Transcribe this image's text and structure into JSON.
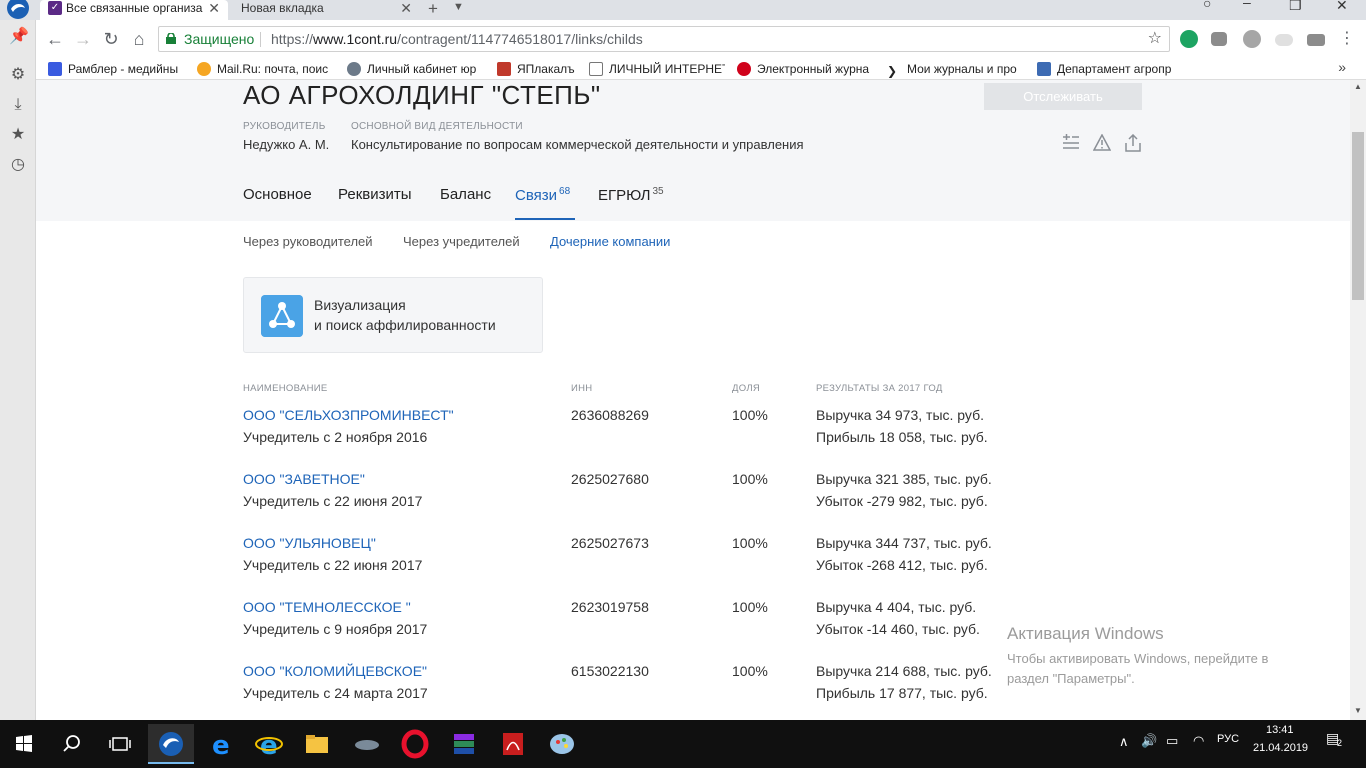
{
  "browser": {
    "tabs": [
      {
        "title": "Все связанные организа",
        "active": true
      },
      {
        "title": "Новая вкладка",
        "active": false
      }
    ],
    "security_label": "Защищено",
    "url_prefix": "https://",
    "url_host": "www.1cont.ru",
    "url_path": "/contragent/1147746518017/links/childs",
    "bookmarks": [
      "Рамблер - медийны",
      "Mail.Ru: почта, поис",
      "Личный кабинет юр",
      "ЯПлакалъ",
      "ЛИЧНЫЙ ИНТЕРНЕТ",
      "Электронный журна",
      "Мои журналы и про",
      "Департамент агропр"
    ]
  },
  "company": {
    "title": "АО АГРОХОЛДИНГ \"СТЕПЬ\"",
    "track_button": "Отслеживать",
    "director_label": "РУКОВОДИТЕЛЬ",
    "director_value": "Недужко А. М.",
    "activity_label": "ОСНОВНОЙ ВИД ДЕЯТЕЛЬНОСТИ",
    "activity_value": "Консультирование по вопросам коммерческой деятельности и управления"
  },
  "tabs": [
    {
      "label": "Основное",
      "count": ""
    },
    {
      "label": "Реквизиты",
      "count": ""
    },
    {
      "label": "Баланс",
      "count": ""
    },
    {
      "label": "Связи",
      "count": "68"
    },
    {
      "label": "ЕГРЮЛ",
      "count": "35"
    }
  ],
  "subnav": [
    "Через руководителей",
    "Через учредителей",
    "Дочерние компании"
  ],
  "viz_card": {
    "line1": "Визуализация",
    "line2": "и поиск аффилированности"
  },
  "table": {
    "headers": [
      "НАИМЕНОВАНИЕ",
      "ИНН",
      "ДОЛЯ",
      "РЕЗУЛЬТАТЫ ЗА 2017 ГОД"
    ],
    "rows": [
      {
        "name": "ООО \"СЕЛЬХОЗПРОМИНВЕСТ\"",
        "since": "Учредитель с 2 ноября 2016",
        "inn": "2636088269",
        "share": "100%",
        "r1": "Выручка 34 973, тыс. руб.",
        "r2": "Прибыль 18 058, тыс. руб."
      },
      {
        "name": "ООО \"ЗАВЕТНОЕ\"",
        "since": "Учредитель с 22 июня 2017",
        "inn": "2625027680",
        "share": "100%",
        "r1": "Выручка 321 385, тыс. руб.",
        "r2": "Убыток -279 982, тыс. руб."
      },
      {
        "name": "ООО \"УЛЬЯНОВЕЦ\"",
        "since": "Учредитель с 22 июня 2017",
        "inn": "2625027673",
        "share": "100%",
        "r1": "Выручка 344 737, тыс. руб.",
        "r2": "Убыток -268 412, тыс. руб."
      },
      {
        "name": "ООО \"ТЕМНОЛЕССКОЕ \"",
        "since": "Учредитель с 9 ноября 2017",
        "inn": "2623019758",
        "share": "100%",
        "r1": "Выручка 4 404, тыс. руб.",
        "r2": "Убыток -14 460, тыс. руб."
      },
      {
        "name": "ООО \"КОЛОМИЙЦЕВСКОЕ\"",
        "since": "Учредитель с 24 марта 2017",
        "inn": "6153022130",
        "share": "100%",
        "r1": "Выручка 214 688, тыс. руб.",
        "r2": "Прибыль 17 877, тыс. руб."
      }
    ]
  },
  "watermark": {
    "title": "Активация Windows",
    "line1": "Чтобы активировать Windows, перейдите в",
    "line2": "раздел \"Параметры\"."
  },
  "taskbar": {
    "lang": "РУС",
    "time": "13:41",
    "date": "21.04.2019",
    "notifications": "2"
  },
  "colors": {
    "link": "#1e64b8",
    "header_bg": "#f5f6f8",
    "secure_green": "#188038"
  }
}
